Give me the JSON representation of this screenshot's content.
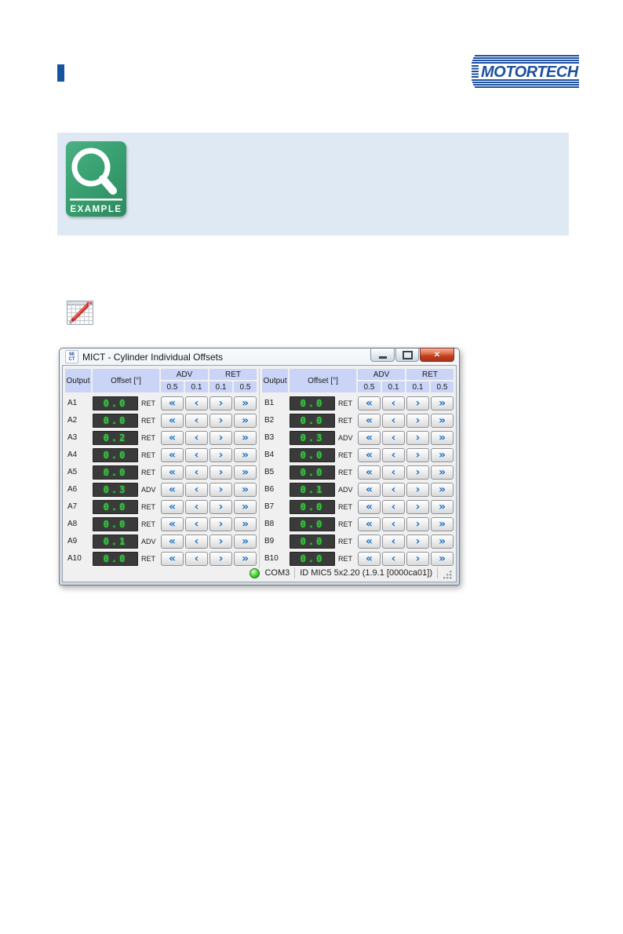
{
  "colors": {
    "accent_blue": "#1d509e",
    "header_cell_bg": "#c9d4f7",
    "lcd_green": "#30c83a",
    "led_green": "#43d22f",
    "example_green": "#38a071",
    "example_box_bg": "#dfe9f4",
    "close_button_red": "#c23f20"
  },
  "logo": {
    "text": "MOTORTECH"
  },
  "example": {
    "label": "EXAMPLE"
  },
  "dialog": {
    "title": "MICT - Cylinder Individual Offsets",
    "app_icon": {
      "top": "MI",
      "bottom": "CT"
    },
    "columns": {
      "output": "Output",
      "offset": "Offset [°]",
      "adv": "ADV",
      "ret": "RET",
      "steps": [
        "0.5",
        "0.1",
        "0.1",
        "0.5"
      ]
    },
    "nudge_buttons": [
      {
        "name": "adv-large-step",
        "glyph": "«"
      },
      {
        "name": "adv-small-step",
        "glyph": "‹"
      },
      {
        "name": "ret-small-step",
        "glyph": "›"
      },
      {
        "name": "ret-large-step",
        "glyph": "»"
      }
    ],
    "banks": [
      {
        "rows": [
          {
            "output": "A1",
            "value": "0.0",
            "direction": "RET"
          },
          {
            "output": "A2",
            "value": "0.0",
            "direction": "RET"
          },
          {
            "output": "A3",
            "value": "0.2",
            "direction": "RET"
          },
          {
            "output": "A4",
            "value": "0.0",
            "direction": "RET"
          },
          {
            "output": "A5",
            "value": "0.0",
            "direction": "RET"
          },
          {
            "output": "A6",
            "value": "0.3",
            "direction": "ADV"
          },
          {
            "output": "A7",
            "value": "0.0",
            "direction": "RET"
          },
          {
            "output": "A8",
            "value": "0.0",
            "direction": "RET"
          },
          {
            "output": "A9",
            "value": "0.1",
            "direction": "ADV"
          },
          {
            "output": "A10",
            "value": "0.0",
            "direction": "RET"
          }
        ]
      },
      {
        "rows": [
          {
            "output": "B1",
            "value": "0.0",
            "direction": "RET"
          },
          {
            "output": "B2",
            "value": "0.0",
            "direction": "RET"
          },
          {
            "output": "B3",
            "value": "0.3",
            "direction": "ADV"
          },
          {
            "output": "B4",
            "value": "0.0",
            "direction": "RET"
          },
          {
            "output": "B5",
            "value": "0.0",
            "direction": "RET"
          },
          {
            "output": "B6",
            "value": "0.1",
            "direction": "ADV"
          },
          {
            "output": "B7",
            "value": "0.0",
            "direction": "RET"
          },
          {
            "output": "B8",
            "value": "0.0",
            "direction": "RET"
          },
          {
            "output": "B9",
            "value": "0.0",
            "direction": "RET"
          },
          {
            "output": "B10",
            "value": "0.0",
            "direction": "RET"
          }
        ]
      }
    ],
    "status": {
      "port": "COM3",
      "device_id": "ID MIC5 5x2.20 (1.9.1 [0000ca01])"
    }
  }
}
